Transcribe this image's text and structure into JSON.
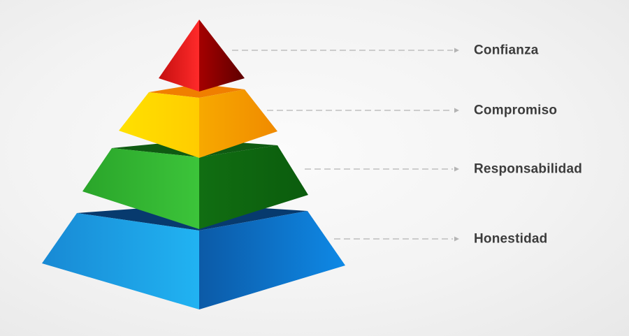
{
  "levels": [
    {
      "label": "Confianza"
    },
    {
      "label": "Compromiso"
    },
    {
      "label": "Responsabilidad"
    },
    {
      "label": "Honestidad"
    }
  ],
  "colors": {
    "confianza_light": "#e21a1a",
    "confianza_dark": "#8a0000",
    "compromiso_light": "#ffd200",
    "compromiso_dark": "#f39a00",
    "responsabilidad_light": "#35b233",
    "responsabilidad_dark": "#0d6e10",
    "honestidad_light": "#1aa3e8",
    "honestidad_dark": "#0a4f98",
    "connector": "#b4b4b4",
    "label_text": "#3c3c3c"
  }
}
